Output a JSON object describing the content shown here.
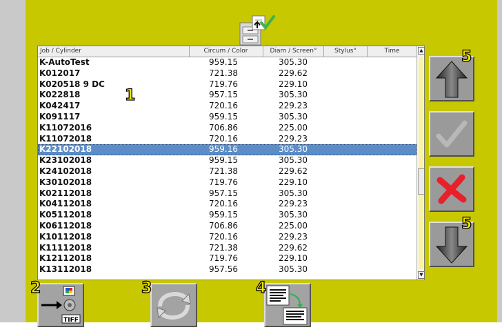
{
  "columns": [
    "Job / Cylinder",
    "Circum / Color",
    "Diam / Screen°",
    "Stylus°",
    "Time"
  ],
  "rows": [
    {
      "job": "K-AutoTest",
      "circum": "959.15",
      "diam": "305.30"
    },
    {
      "job": "K012017",
      "circum": "721.38",
      "diam": "229.62"
    },
    {
      "job": "K020518 9 DC",
      "circum": "719.76",
      "diam": "229.10"
    },
    {
      "job": "K022818",
      "circum": "957.15",
      "diam": "305.30"
    },
    {
      "job": "K042417",
      "circum": "720.16",
      "diam": "229.23"
    },
    {
      "job": "K091117",
      "circum": "959.15",
      "diam": "305.30"
    },
    {
      "job": "K11072016",
      "circum": "706.86",
      "diam": "225.00"
    },
    {
      "job": "K11072018",
      "circum": "720.16",
      "diam": "229.23"
    },
    {
      "job": "K22102018",
      "circum": "959.16",
      "diam": "305.30"
    },
    {
      "job": "K23102018",
      "circum": "959.15",
      "diam": "305.30"
    },
    {
      "job": "K24102018",
      "circum": "721.38",
      "diam": "229.62"
    },
    {
      "job": "K30102018",
      "circum": "719.76",
      "diam": "229.10"
    },
    {
      "job": "K02112018",
      "circum": "957.15",
      "diam": "305.30"
    },
    {
      "job": "K04112018",
      "circum": "720.16",
      "diam": "229.23"
    },
    {
      "job": "K05112018",
      "circum": "959.15",
      "diam": "305.30"
    },
    {
      "job": "K06112018",
      "circum": "706.86",
      "diam": "225.00"
    },
    {
      "job": "K10112018",
      "circum": "720.16",
      "diam": "229.23"
    },
    {
      "job": "K11112018",
      "circum": "721.38",
      "diam": "229.62"
    },
    {
      "job": "K12112018",
      "circum": "719.76",
      "diam": "229.10"
    },
    {
      "job": "K13112018",
      "circum": "957.56",
      "diam": "305.30"
    }
  ],
  "selected_row": "K22102018",
  "callouts": {
    "list": "1",
    "tiff": "2",
    "refresh": "3",
    "transfer": "4",
    "up": "5",
    "down": "5"
  },
  "tiff_label": "TIFF",
  "icons": {
    "top": "file-cabinet-check-icon",
    "up": "arrow-up-icon",
    "ok": "checkmark-icon",
    "cancel": "red-x-icon",
    "down": "arrow-down-icon",
    "tiff": "tiff-export-icon",
    "refresh": "refresh-icon",
    "transfer": "document-transfer-icon"
  },
  "colors": {
    "panel": "#c8c800",
    "selection": "#5b8dc8",
    "cancel": "#e8202a",
    "callout": "#f5e800"
  }
}
